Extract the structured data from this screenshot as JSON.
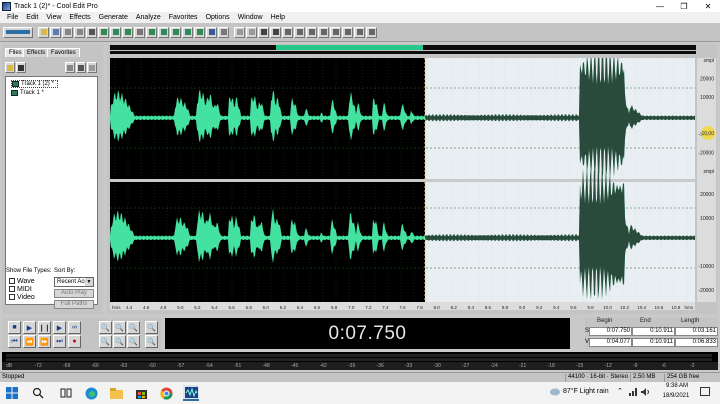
{
  "window": {
    "title": "Track 1 (2)* - Cool Edit Pro"
  },
  "menu": [
    "File",
    "Edit",
    "View",
    "Effects",
    "Generate",
    "Analyze",
    "Favorites",
    "Options",
    "Window",
    "Help"
  ],
  "organizer": {
    "tabs": [
      "Files",
      "Effects",
      "Favorites"
    ],
    "files": [
      "Track 1 (2) *",
      "Track 1 *"
    ],
    "show_file_types_label": "Show File Types:",
    "sort_by_label": "Sort By:",
    "sort_value": "Recent Acc",
    "file_types": [
      "Wave",
      "MIDI",
      "Video"
    ],
    "auto_play_label": "Auto Play",
    "full_paths_label": "Full Paths"
  },
  "rulers": {
    "v_top": [
      "smpl",
      "20000",
      "10000",
      "",
      "-10000",
      "-20000",
      "smpl"
    ],
    "v_bot": [
      "20000",
      "10000",
      "",
      "-10000",
      "-20000"
    ],
    "h": [
      "hms",
      "4.4",
      "4.6",
      "4.8",
      "5.0",
      "5.2",
      "5.4",
      "5.6",
      "5.8",
      "6.0",
      "6.2",
      "6.4",
      "6.6",
      "6.8",
      "7.0",
      "7.2",
      "7.4",
      "7.6",
      "7.8",
      "8.0",
      "8.2",
      "8.4",
      "8.6",
      "8.8",
      "9.0",
      "9.2",
      "9.4",
      "9.6",
      "9.8",
      "10.0",
      "10.2",
      "10.4",
      "10.6",
      "10.8",
      "hms"
    ],
    "cursor_db": "-10,00"
  },
  "transport": {
    "time": "0:07.750"
  },
  "selection": {
    "headers": [
      "Begin",
      "End",
      "Length"
    ],
    "sel_label": "Sel",
    "view_label": "View",
    "sel": [
      "0:07.750",
      "0:10.911",
      "0:03.161"
    ],
    "view": [
      "0:04.077",
      "0:10.911",
      "0:06.833"
    ]
  },
  "level_meter": {
    "labels": [
      "dB",
      "-72",
      "-69",
      "-66",
      "-63",
      "-60",
      "-57",
      "-54",
      "-51",
      "-48",
      "-45",
      "-42",
      "-39",
      "-36",
      "-33",
      "-30",
      "-27",
      "-24",
      "-21",
      "-18",
      "-15",
      "-12",
      "-9",
      "-6",
      "-3",
      "0"
    ]
  },
  "status": {
    "left": "Stopped",
    "rate": "44100 · 16-bit · Stereo",
    "size": "2.50 MB",
    "free": "254 GB free"
  },
  "taskbar": {
    "weather": "87°F  Light rain",
    "time": "9:38 AM",
    "date": "18/9/2021"
  },
  "colors": {
    "wave": "#44e2a0",
    "selection_bg": "#e9eef2",
    "dark_wave": "#2a4a3c",
    "accent": "#27c78a"
  }
}
